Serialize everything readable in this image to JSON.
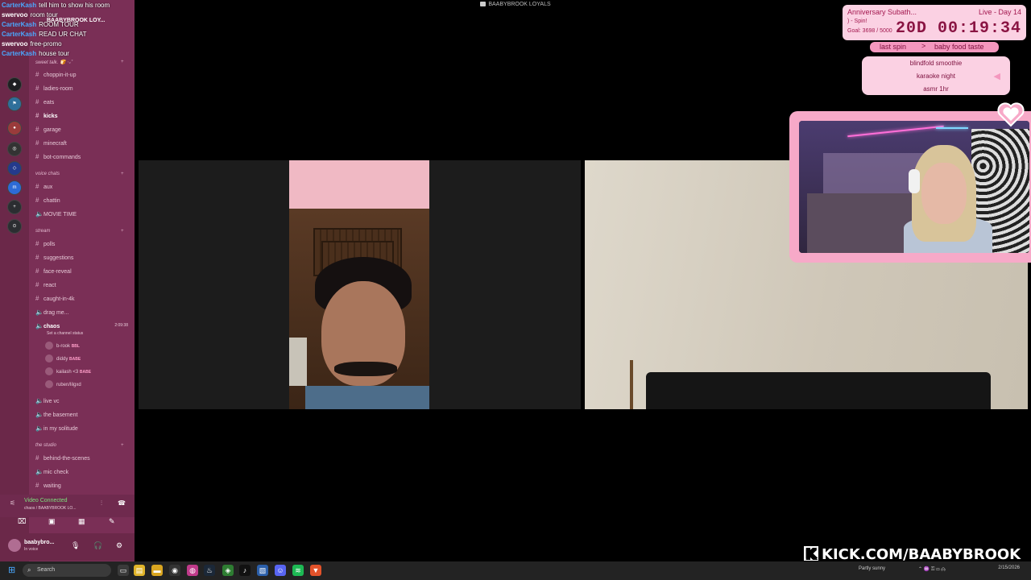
{
  "window_title": "BAABYBROOK LOYALS",
  "chat": [
    {
      "user": "CarterKash",
      "msg": "tell him to show his room",
      "color": "#4aa8ff"
    },
    {
      "user": "swervoo",
      "msg": "room tour",
      "color": "#ffffff"
    },
    {
      "user": "CarterKash",
      "msg": "ROOM TOUR",
      "color": "#4aa8ff"
    },
    {
      "user": "CarterKash",
      "msg": "READ UR CHAT",
      "color": "#4aa8ff"
    },
    {
      "user": "swervoo",
      "msg": "free-promo",
      "color": "#ffffff"
    },
    {
      "user": "CarterKash",
      "msg": "house tour",
      "color": "#4aa8ff"
    }
  ],
  "server": {
    "name": "BAABYBROOK LOY..."
  },
  "channels": {
    "cat_sweet_talk": "sweet talk. 🍞 ‧₊˚",
    "items_1": [
      "choppin-it-up",
      "ladies-room",
      "eats",
      "kicks",
      "garage",
      "minecraft",
      "bot-commands"
    ],
    "cat_voice": "voice chats",
    "voice_items": [
      "aux",
      "chattin",
      "MOVIE TIME"
    ],
    "cat_stream": "stream",
    "stream_items": [
      "polls",
      "suggestions",
      "face-reveal",
      "react",
      "caught-in-4k",
      "drag me..."
    ],
    "chaos": {
      "name": "chaos",
      "time": "2:09:38",
      "status": "Set a channel status"
    },
    "vc_users": [
      {
        "name": "b-rook",
        "tag": "BBL"
      },
      {
        "name": "diddy",
        "tag": "BABE"
      },
      {
        "name": "kailash <3",
        "tag": "BABE"
      },
      {
        "name": "ruben/lilgxd",
        "tag": ""
      }
    ],
    "more_voice": [
      "live vc",
      "the basement",
      "in my solitude"
    ],
    "cat_studio": "the studio",
    "studio_items": [
      "behind-the-scenes",
      "mic check",
      "waiting"
    ]
  },
  "voice_panel": {
    "status": "Video Connected",
    "sub": "chaos / BAABYBROOK LO..."
  },
  "user_bar": {
    "name": "baabybro...",
    "status": "In voice"
  },
  "subathon": {
    "title": "Anniversary Subath...",
    "live": "Live - Day 14",
    "spin": ") - Spin!",
    "goal": "Goal: 3698 / 5000",
    "timer": "20D 00:19:34"
  },
  "spin": {
    "last": "last spin",
    "arrow": ">",
    "current": "baby food taste",
    "options": [
      "blindfold smoothie",
      "karaoke night",
      "asmr 1hr"
    ]
  },
  "kick_url": "KICK.COM/BAABYBROOK",
  "taskbar": {
    "search_placeholder": "Search",
    "weather": "Partly sunny",
    "date": "2/15/2026"
  },
  "colors": {
    "sidebar": "#7a2f56",
    "accent_pink": "#f7a9c8",
    "live_green": "#7de07d"
  }
}
